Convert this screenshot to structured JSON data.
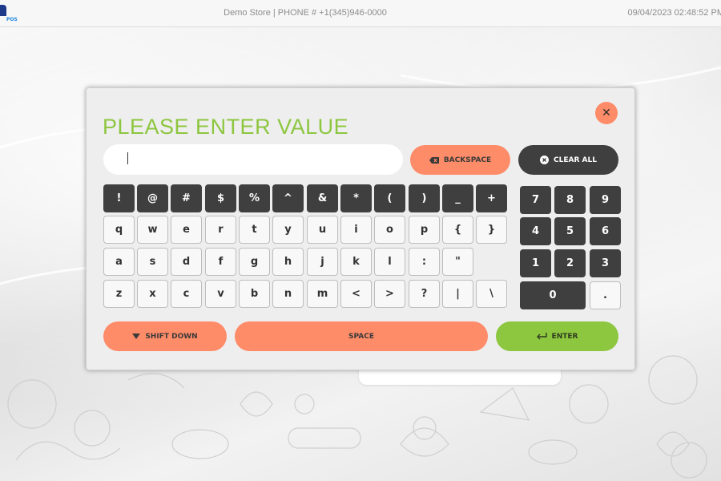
{
  "header": {
    "logo_text": "POS",
    "store_info": "Demo Store | PHONE # +1(345)946-0000",
    "datetime": "09/04/2023 02:48:52 PM"
  },
  "modal": {
    "title": "PLEASE ENTER VALUE",
    "input_value": "",
    "close_icon": "close-icon",
    "backspace_label": "BACKSPACE",
    "clear_all_label": "CLEAR ALL",
    "shift_label": "SHIFT DOWN",
    "space_label": "SPACE",
    "enter_label": "ENTER"
  },
  "keyboard": {
    "row1": [
      "!",
      "@",
      "#",
      "$",
      "%",
      "^",
      "&",
      "*",
      "(",
      ")",
      "_",
      "+"
    ],
    "row2": [
      "q",
      "w",
      "e",
      "r",
      "t",
      "y",
      "u",
      "i",
      "o",
      "p",
      "{",
      "}"
    ],
    "row3": [
      "a",
      "s",
      "d",
      "f",
      "g",
      "h",
      "j",
      "k",
      "l",
      ":",
      "\""
    ],
    "row4": [
      "z",
      "x",
      "c",
      "v",
      "b",
      "n",
      "m",
      "<",
      ">",
      "?",
      "|",
      "\\"
    ]
  },
  "numpad": {
    "row1": [
      "7",
      "8",
      "9"
    ],
    "row2": [
      "4",
      "5",
      "6"
    ],
    "row3": [
      "1",
      "2",
      "3"
    ],
    "row4": [
      "0",
      "."
    ]
  },
  "colors": {
    "accent_orange": "#ff8c69",
    "accent_green": "#8dc63f",
    "dark_key": "#3f3f3f"
  }
}
